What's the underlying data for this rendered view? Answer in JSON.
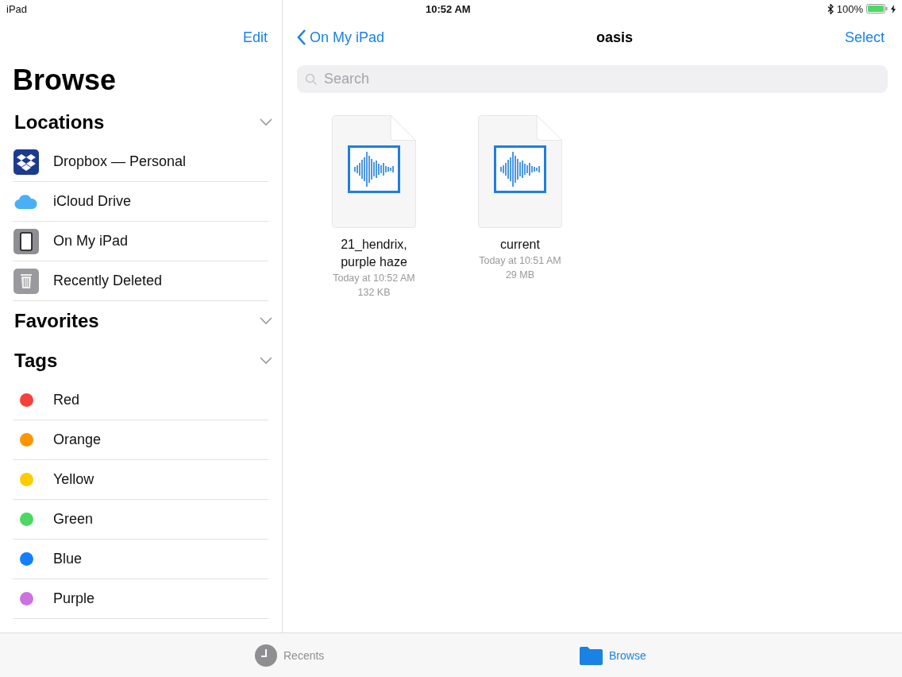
{
  "status_bar": {
    "device": "iPad",
    "time": "10:52 AM",
    "battery": "100%",
    "charging": true
  },
  "sidebar": {
    "edit": "Edit",
    "title": "Browse",
    "sections": [
      {
        "title": "Locations",
        "expanded": true,
        "items": [
          {
            "label": "Dropbox — Personal",
            "kind": "dropbox"
          },
          {
            "label": "iCloud Drive",
            "kind": "icloud"
          },
          {
            "label": "On My iPad",
            "kind": "ipad"
          },
          {
            "label": "Recently Deleted",
            "kind": "trash"
          }
        ]
      },
      {
        "title": "Favorites",
        "expanded": true
      },
      {
        "title": "Tags",
        "expanded": true,
        "items": [
          {
            "label": "Red",
            "kind": "tag",
            "color": "#f5413a"
          },
          {
            "label": "Orange",
            "kind": "tag",
            "color": "#fd9500"
          },
          {
            "label": "Yellow",
            "kind": "tag",
            "color": "#fecb00"
          },
          {
            "label": "Green",
            "kind": "tag",
            "color": "#4cd863"
          },
          {
            "label": "Blue",
            "kind": "tag",
            "color": "#147ffb"
          },
          {
            "label": "Purple",
            "kind": "tag",
            "color": "#cc72e0"
          }
        ]
      }
    ]
  },
  "nav": {
    "back": "On My iPad",
    "title": "oasis",
    "select": "Select"
  },
  "search": {
    "placeholder": "Search"
  },
  "files": [
    {
      "name": "21_hendrix, purple haze",
      "date": "Today at 10:52 AM",
      "size": "132 KB"
    },
    {
      "name": "current",
      "date": "Today at 10:51 AM",
      "size": "29 MB"
    }
  ],
  "tabs": [
    {
      "label": "Recents",
      "kind": "recents",
      "selected": false
    },
    {
      "label": "Browse",
      "kind": "browse",
      "selected": true
    }
  ]
}
